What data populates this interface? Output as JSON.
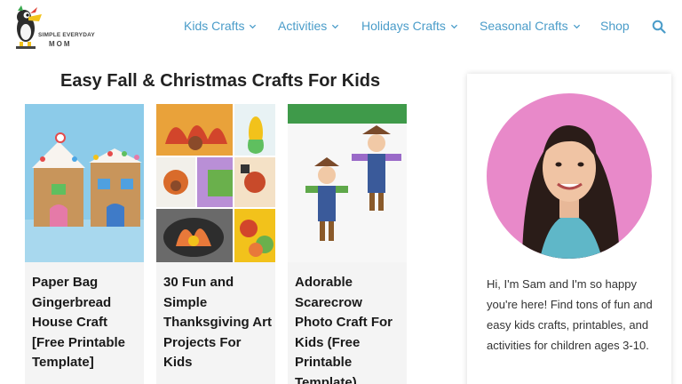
{
  "logo": {
    "line1": "SIMPLE EVERYDAY",
    "line2": "MOM"
  },
  "nav": {
    "items": [
      {
        "label": "Kids Crafts",
        "has_dropdown": true
      },
      {
        "label": "Activities",
        "has_dropdown": true
      },
      {
        "label": "Holidays Crafts",
        "has_dropdown": true
      },
      {
        "label": "Seasonal Crafts",
        "has_dropdown": true
      },
      {
        "label": "Shop",
        "has_dropdown": false
      }
    ],
    "search_icon": "search-icon"
  },
  "section": {
    "title": "Easy Fall & Christmas Crafts For Kids"
  },
  "cards": [
    {
      "title": "Paper Bag Gingerbread House Craft [Free Printable Template]"
    },
    {
      "title": "30 Fun and Simple Thanksgiving Art Projects For Kids"
    },
    {
      "title": "Adorable Scarecrow Photo Craft For Kids (Free Printable Template)"
    }
  ],
  "sidebar": {
    "bio": "Hi, I'm Sam and I'm so happy you're here! Find tons of fun and easy kids crafts, printables, and activities for children ages 3-10."
  },
  "colors": {
    "nav_link": "#4a9cc9",
    "avatar_bg": "#e889c9",
    "card_bg": "#f4f4f4"
  }
}
